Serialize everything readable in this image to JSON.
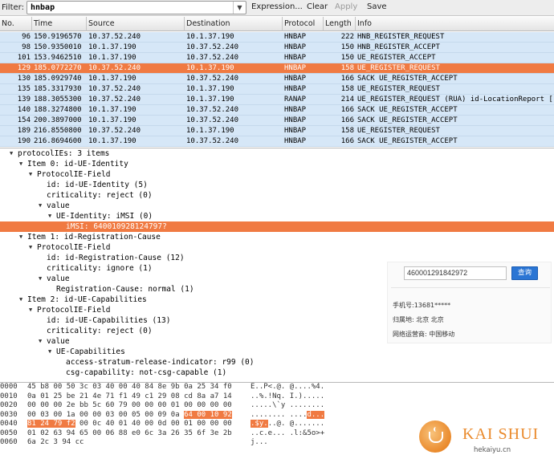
{
  "toolbar": {
    "filter_label": "Filter:",
    "filter_value": "hnbap",
    "expression_label": "Expression...",
    "clear_label": "Clear",
    "apply_label": "Apply",
    "save_label": "Save"
  },
  "packet_list": {
    "columns": [
      "No.",
      "Time",
      "Source",
      "Destination",
      "Protocol",
      "Length",
      "Info"
    ],
    "rows": [
      {
        "no": "96",
        "time": "150.9196570",
        "source": "10.37.52.240",
        "destination": "10.1.37.190",
        "protocol": "HNBAP",
        "length": "222",
        "info": "HNB_REGISTER_REQUEST",
        "selected": false
      },
      {
        "no": "98",
        "time": "150.9350010",
        "source": "10.1.37.190",
        "destination": "10.37.52.240",
        "protocol": "HNBAP",
        "length": "150",
        "info": "HNB_REGISTER_ACCEPT",
        "selected": false
      },
      {
        "no": "101",
        "time": "153.9462510",
        "source": "10.1.37.190",
        "destination": "10.37.52.240",
        "protocol": "HNBAP",
        "length": "150",
        "info": "UE_REGISTER_ACCEPT",
        "selected": false
      },
      {
        "no": "129",
        "time": "185.0772270",
        "source": "10.37.52.240",
        "destination": "10.1.37.190",
        "protocol": "HNBAP",
        "length": "158",
        "info": "UE_REGISTER_REQUEST",
        "selected": true
      },
      {
        "no": "130",
        "time": "185.0929740",
        "source": "10.1.37.190",
        "destination": "10.37.52.240",
        "protocol": "HNBAP",
        "length": "166",
        "info": "SACK UE_REGISTER_ACCEPT",
        "selected": false
      },
      {
        "no": "135",
        "time": "185.3317930",
        "source": "10.37.52.240",
        "destination": "10.1.37.190",
        "protocol": "HNBAP",
        "length": "158",
        "info": "UE_REGISTER_REQUEST",
        "selected": false
      },
      {
        "no": "139",
        "time": "188.3055300",
        "source": "10.37.52.240",
        "destination": "10.1.37.190",
        "protocol": "RANAP",
        "length": "214",
        "info": "UE_REGISTER_REQUEST (RUA) id-LocationReport [",
        "selected": false
      },
      {
        "no": "140",
        "time": "188.3274800",
        "source": "10.1.37.190",
        "destination": "10.37.52.240",
        "protocol": "HNBAP",
        "length": "166",
        "info": "SACK UE_REGISTER_ACCEPT",
        "selected": false
      },
      {
        "no": "154",
        "time": "200.3897000",
        "source": "10.1.37.190",
        "destination": "10.37.52.240",
        "protocol": "HNBAP",
        "length": "166",
        "info": "SACK UE_REGISTER_ACCEPT",
        "selected": false
      },
      {
        "no": "189",
        "time": "216.8550800",
        "source": "10.37.52.240",
        "destination": "10.1.37.190",
        "protocol": "HNBAP",
        "length": "158",
        "info": "UE_REGISTER_REQUEST",
        "selected": false
      },
      {
        "no": "190",
        "time": "216.8694600",
        "source": "10.1.37.190",
        "destination": "10.37.52.240",
        "protocol": "HNBAP",
        "length": "166",
        "info": "SACK UE_REGISTER_ACCEPT",
        "selected": false
      }
    ]
  },
  "details": {
    "lines": [
      {
        "text": "protocolIEs: 3 items",
        "indent": 0,
        "arrow": "down",
        "selected": false
      },
      {
        "text": "Item 0: id-UE-Identity",
        "indent": 1,
        "arrow": "down",
        "selected": false
      },
      {
        "text": "ProtocolIE-Field",
        "indent": 2,
        "arrow": "down",
        "selected": false
      },
      {
        "text": "id: id-UE-Identity (5)",
        "indent": 3,
        "arrow": "",
        "selected": false
      },
      {
        "text": "criticality: reject (0)",
        "indent": 3,
        "arrow": "",
        "selected": false
      },
      {
        "text": "value",
        "indent": 3,
        "arrow": "down",
        "selected": false
      },
      {
        "text": "UE-Identity: iMSI (0)",
        "indent": 4,
        "arrow": "down",
        "selected": false
      },
      {
        "text": "iMSI: 640010928124797?",
        "indent": 5,
        "arrow": "",
        "selected": true
      },
      {
        "text": "Item 1: id-Registration-Cause",
        "indent": 1,
        "arrow": "down",
        "selected": false
      },
      {
        "text": "ProtocolIE-Field",
        "indent": 2,
        "arrow": "down",
        "selected": false
      },
      {
        "text": "id: id-Registration-Cause (12)",
        "indent": 3,
        "arrow": "",
        "selected": false
      },
      {
        "text": "criticality: ignore (1)",
        "indent": 3,
        "arrow": "",
        "selected": false
      },
      {
        "text": "value",
        "indent": 3,
        "arrow": "down",
        "selected": false
      },
      {
        "text": "Registration-Cause: normal (1)",
        "indent": 4,
        "arrow": "",
        "selected": false
      },
      {
        "text": "Item 2: id-UE-Capabilities",
        "indent": 1,
        "arrow": "down",
        "selected": false
      },
      {
        "text": "ProtocolIE-Field",
        "indent": 2,
        "arrow": "down",
        "selected": false
      },
      {
        "text": "id: id-UE-Capabilities (13)",
        "indent": 3,
        "arrow": "",
        "selected": false
      },
      {
        "text": "criticality: reject (0)",
        "indent": 3,
        "arrow": "",
        "selected": false
      },
      {
        "text": "value",
        "indent": 3,
        "arrow": "down",
        "selected": false
      },
      {
        "text": "UE-Capabilities",
        "indent": 4,
        "arrow": "down",
        "selected": false
      },
      {
        "text": "access-stratum-release-indicator: r99 (0)",
        "indent": 5,
        "arrow": "",
        "selected": false
      },
      {
        "text": "csg-capability: not-csg-capable (1)",
        "indent": 5,
        "arrow": "",
        "selected": false
      }
    ]
  },
  "lookup": {
    "input_value": "460001291842972",
    "button_label": "查询",
    "phone_line": "手机号:13681*****",
    "location_line": "归属地: 北京 北京",
    "carrier_line": "网络运营商: 中国移动"
  },
  "bytes": {
    "rows": [
      {
        "offset": "0000",
        "hex": [
          {
            "t": "45 b8 00 50 3c 03 40 00  40 84 8e 9b 0a 25 34 f0",
            "h": false
          }
        ],
        "ascii": [
          {
            "t": "E..P<.@. @....%4.",
            "h": false
          }
        ]
      },
      {
        "offset": "0010",
        "hex": [
          {
            "t": "0a 01 25 be 21 4e 71 f1  49 c1 29 08 cd 8a a7 14",
            "h": false
          }
        ],
        "ascii": [
          {
            "t": "..%.!Nq. I.).....",
            "h": false
          }
        ]
      },
      {
        "offset": "0020",
        "hex": [
          {
            "t": "00 00 00 2e bb 5c 60 79  00 00 00 01 00 00 00 00",
            "h": false
          }
        ],
        "ascii": [
          {
            "t": ".....\\`y ........",
            "h": false
          }
        ]
      },
      {
        "offset": "0030",
        "hex": [
          {
            "t": "00 03 00 1a 00 00 03 00  05 00 09 0a ",
            "h": false
          },
          {
            "t": "64 00 10 92",
            "h": true
          }
        ],
        "ascii": [
          {
            "t": "........ ....",
            "h": false
          },
          {
            "t": "d...",
            "h": true
          }
        ]
      },
      {
        "offset": "0040",
        "hex": [
          {
            "t": "81 24 79 f2",
            "h": true
          },
          {
            "t": " 00 0c 40 01  40 00 0d 00 01 00 00 00",
            "h": false
          }
        ],
        "ascii": [
          {
            "t": ".$y.",
            "h": true
          },
          {
            "t": "..@. @.......",
            "h": false
          }
        ]
      },
      {
        "offset": "0050",
        "hex": [
          {
            "t": "01 02 63 94 65 00 06 88  e0 6c 3a 26 35 6f 3e 2b",
            "h": false
          }
        ],
        "ascii": [
          {
            "t": "..c.e... .l:&5o>+",
            "h": false
          }
        ]
      },
      {
        "offset": "0060",
        "hex": [
          {
            "t": "6a 2c 3 94 cc",
            "h": false
          }
        ],
        "ascii": [
          {
            "t": "j...",
            "h": false
          }
        ]
      }
    ]
  },
  "watermark": {
    "name": "KAI SHUI",
    "url": "hekaiyu.cn"
  }
}
